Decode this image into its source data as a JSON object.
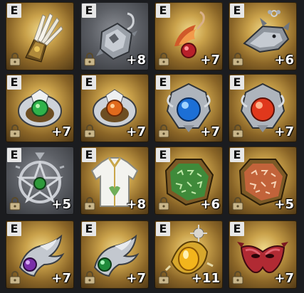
{
  "items": [
    {
      "name": "feathered-gauntlet",
      "grade": "E",
      "level": "",
      "bg": "gold",
      "icon": "feathered-gauntlet-icon"
    },
    {
      "name": "silver-dragon-earring",
      "grade": "E",
      "level": "+8",
      "bg": "gray",
      "icon": "silver-dragon-earring-icon"
    },
    {
      "name": "flame-ruby-earring",
      "grade": "E",
      "level": "+7",
      "bg": "gold",
      "icon": "flame-ruby-earring-icon"
    },
    {
      "name": "dragon-head-earring",
      "grade": "E",
      "level": "+6",
      "bg": "gold",
      "icon": "dragon-head-earring-icon"
    },
    {
      "name": "emerald-ring",
      "grade": "E",
      "level": "+7",
      "bg": "gold",
      "icon": "emerald-ring-icon"
    },
    {
      "name": "topaz-ring",
      "grade": "E",
      "level": "+7",
      "bg": "gold",
      "icon": "topaz-ring-icon"
    },
    {
      "name": "sapphire-amulet",
      "grade": "E",
      "level": "+7",
      "bg": "gold",
      "icon": "sapphire-amulet-icon"
    },
    {
      "name": "ruby-amulet",
      "grade": "E",
      "level": "+7",
      "bg": "gold",
      "icon": "ruby-amulet-icon"
    },
    {
      "name": "pentagram-amulet",
      "grade": "E",
      "level": "+5",
      "bg": "gray",
      "icon": "pentagram-amulet-icon"
    },
    {
      "name": "white-robe",
      "grade": "E",
      "level": "+8",
      "bg": "gold",
      "icon": "white-robe-icon"
    },
    {
      "name": "green-rune-tablet",
      "grade": "E",
      "level": "+6",
      "bg": "gold",
      "icon": "green-rune-tablet-icon"
    },
    {
      "name": "orange-rune-tablet",
      "grade": "E",
      "level": "+5",
      "bg": "gold",
      "icon": "orange-rune-tablet-icon"
    },
    {
      "name": "amethyst-wing-ornament",
      "grade": "E",
      "level": "+7",
      "bg": "gold",
      "icon": "amethyst-wing-ornament-icon"
    },
    {
      "name": "emerald-wing-ornament",
      "grade": "E",
      "level": "+7",
      "bg": "gold",
      "icon": "emerald-wing-ornament-icon"
    },
    {
      "name": "sun-amber-pendant",
      "grade": "E",
      "level": "+11",
      "bg": "gold",
      "icon": "sun-amber-pendant-icon"
    },
    {
      "name": "crimson-mask",
      "grade": "E",
      "level": "+7",
      "bg": "gold",
      "icon": "crimson-mask-icon"
    }
  ],
  "colors": {
    "badge_bg": "#e7e7e7",
    "level_text": "#ffffff",
    "panel_bg": "#1b1c1f"
  }
}
